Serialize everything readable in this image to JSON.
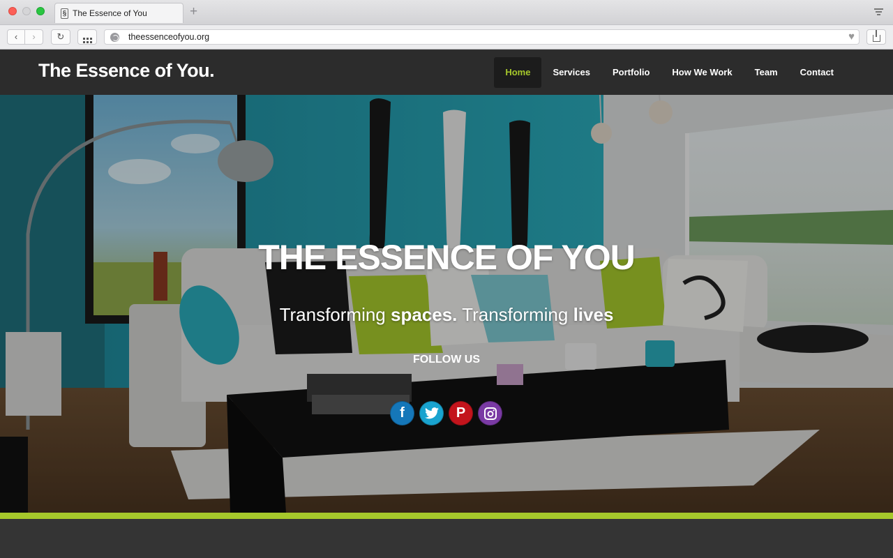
{
  "browser": {
    "tab_title": "The Essence of You",
    "tab_favicon": "§",
    "new_tab": "+",
    "url": "theessenceofyou.org",
    "back_glyph": "‹",
    "forward_glyph": "›",
    "reload_glyph": "↻",
    "bookmark_glyph": "♥"
  },
  "header": {
    "logo": "The Essence of You.",
    "nav": [
      {
        "label": "Home",
        "active": true
      },
      {
        "label": "Services"
      },
      {
        "label": "Portfolio"
      },
      {
        "label": "How We Work"
      },
      {
        "label": "Team"
      },
      {
        "label": "Contact"
      }
    ]
  },
  "hero": {
    "title_part1": "THE ",
    "title_part2": "ESSENCE",
    "title_part3": " OF ",
    "title_part4": "YOU",
    "subtitle_part1": "Transforming ",
    "subtitle_part2": "spaces.",
    "subtitle_part3": " Transforming ",
    "subtitle_part4": "lives",
    "follow_label": "FOLLOW US",
    "social": [
      {
        "name": "facebook",
        "glyph": "f",
        "color": "#1577b9"
      },
      {
        "name": "twitter",
        "glyph": "🐦",
        "color": "#19a3cf"
      },
      {
        "name": "pinterest",
        "glyph": "P",
        "color": "#c3141c"
      },
      {
        "name": "instagram",
        "glyph": "◎",
        "color": "#7a3aa4"
      }
    ]
  },
  "colors": {
    "accent": "#a6c82b",
    "header_bg": "#2c2c2c",
    "footer_bg": "#343434"
  }
}
